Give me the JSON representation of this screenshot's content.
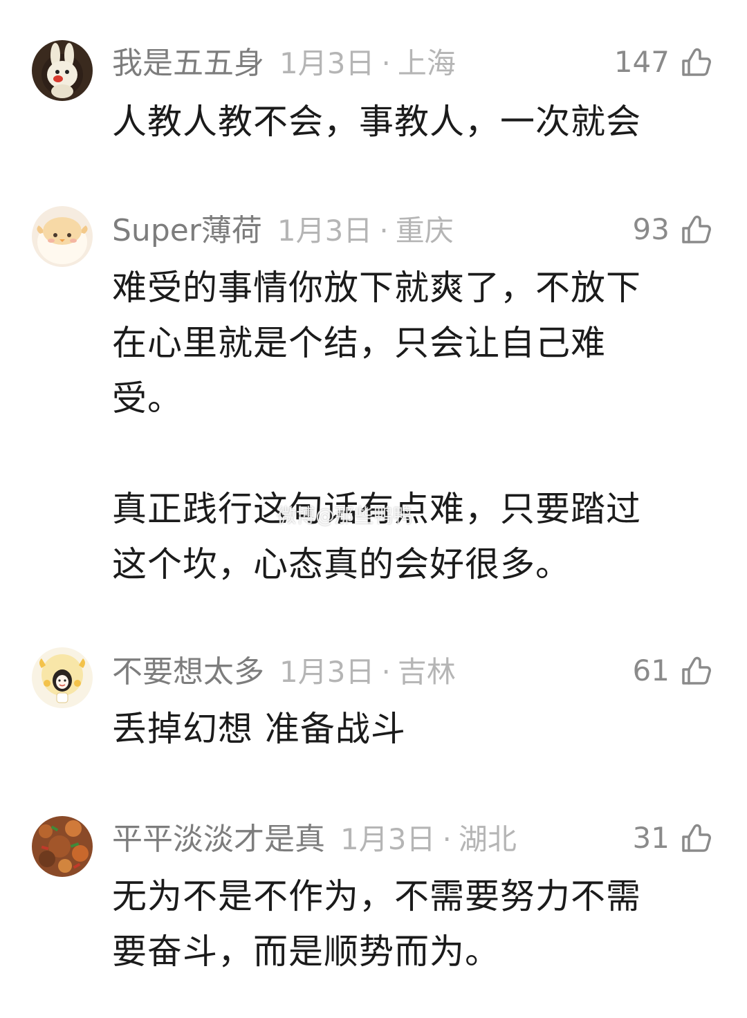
{
  "comments": [
    {
      "username": "我是五五身",
      "date": "1月3日",
      "location": "上海",
      "likes": "147",
      "text": "人教人教不会，事教人，一次就会",
      "avatar": "bunny-avatar"
    },
    {
      "username": "Super薄荷",
      "date": "1月3日",
      "location": "重庆",
      "likes": "93",
      "text": "难受的事情你放下就爽了，不放下\n在心里就是个结，只会让自己难\n受。\n\n真正践行这句话有点难，只要踏过\n这个坎，心态真的会好很多。",
      "avatar": "chick-avatar"
    },
    {
      "username": "不要想太多",
      "date": "1月3日",
      "location": "吉林",
      "likes": "61",
      "text": "丢掉幻想 准备战斗",
      "avatar": "cartoon-girl-avatar"
    },
    {
      "username": "平平淡淡才是真",
      "date": "1月3日",
      "location": "湖北",
      "likes": "31",
      "text": "无为不是不作为，不需要努力不需\n要奋斗，而是顺势而为。",
      "avatar": "food-photo-avatar"
    }
  ],
  "separator": "·",
  "watermark": "微博@那些鸭鸭"
}
